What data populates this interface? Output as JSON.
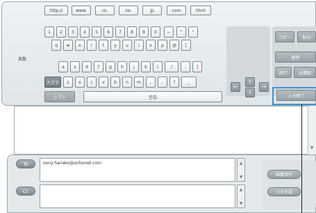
{
  "url_keys": [
    "http://",
    "www.",
    "co.",
    "ne.",
    "jp",
    "com",
    "html"
  ],
  "num_keys": [
    "1",
    "2",
    "3",
    "4",
    "5",
    "6",
    "7",
    "8",
    "9",
    "0",
    "−",
    "^",
    "\""
  ],
  "row_q": [
    "q",
    "w",
    "e",
    "r",
    "t",
    "y",
    "u",
    "i",
    "o",
    "p",
    "@",
    "["
  ],
  "row_a": [
    "a",
    "s",
    "d",
    "f",
    "g",
    "h",
    "j",
    "k",
    "l",
    "/",
    ":",
    "]"
  ],
  "row_z": [
    "z",
    "x",
    "c",
    "v",
    "b",
    "n",
    "m",
    ",",
    ".",
    "?",
    "_"
  ],
  "labels": {
    "eiji": "英数",
    "daimoji": "大文字",
    "shift": "シフト",
    "space": "空白",
    "copy": "コピー",
    "paste": "貼付",
    "delete": "削除",
    "newline": "改行",
    "select_all": "全選択",
    "input_done": "入力終了",
    "arrow_up": "↑",
    "arrow_down": "↓",
    "arrow_left": "←",
    "arrow_right": "→"
  },
  "compose": {
    "to_label": "To",
    "to_value": "sony-hanako@airbonet.com",
    "cc_label": "Cc",
    "cc_value": "",
    "attach_image": "画像添付",
    "memo": "メモ作成"
  }
}
